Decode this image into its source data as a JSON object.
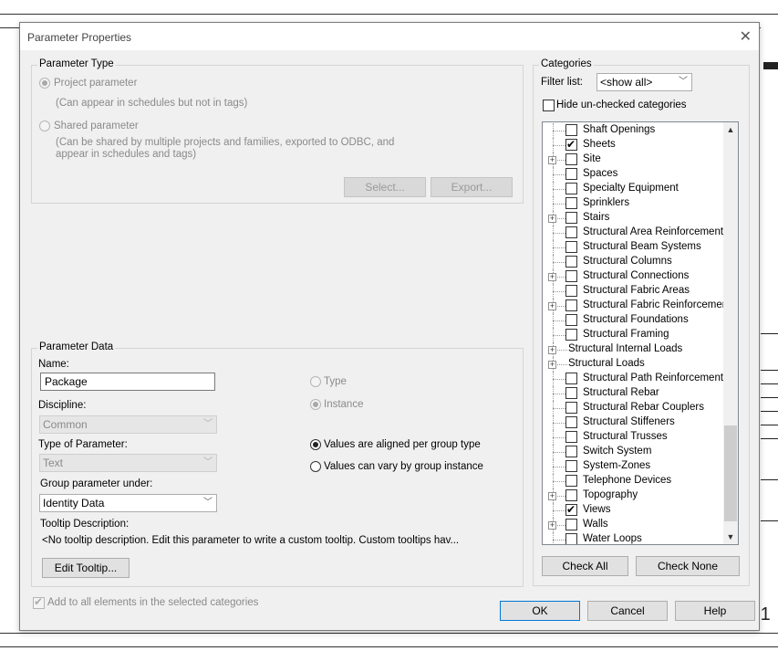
{
  "dialog": {
    "title": "Parameter Properties",
    "close_glyph": "✕"
  },
  "parameter_type": {
    "legend": "Parameter Type",
    "project_label": "Project parameter",
    "project_desc": "(Can appear in schedules but not in tags)",
    "shared_label": "Shared parameter",
    "shared_desc_1": "(Can be shared by multiple projects and families, exported to ODBC, and",
    "shared_desc_2": "appear in schedules and tags)",
    "select_button": "Select...",
    "export_button": "Export..."
  },
  "parameter_data": {
    "legend": "Parameter Data",
    "name_label": "Name:",
    "name_value": "Package",
    "discipline_label": "Discipline:",
    "discipline_value": "Common",
    "type_label": "Type of Parameter:",
    "type_value": "Text",
    "group_label": "Group parameter under:",
    "group_value": "Identity Data",
    "tooltip_label": "Tooltip Description:",
    "tooltip_value": "<No tooltip description. Edit this parameter to write a custom tooltip. Custom tooltips hav...",
    "edit_tooltip_button": "Edit Tooltip...",
    "type_radio": "Type",
    "instance_radio": "Instance",
    "aligned_radio": "Values are aligned per group type",
    "vary_radio": "Values can vary by group instance"
  },
  "categories": {
    "legend": "Categories",
    "filter_label": "Filter list:",
    "filter_value": "<show all>",
    "hide_unchecked_label": "Hide un-checked categories",
    "check_all_button": "Check All",
    "check_none_button": "Check None",
    "items": [
      {
        "label": "Shaft Openings",
        "checked": false,
        "expandable": false,
        "checkbox": true
      },
      {
        "label": "Sheets",
        "checked": true,
        "expandable": false,
        "checkbox": true
      },
      {
        "label": "Site",
        "checked": false,
        "expandable": true,
        "checkbox": true
      },
      {
        "label": "Spaces",
        "checked": false,
        "expandable": false,
        "checkbox": true
      },
      {
        "label": "Specialty Equipment",
        "checked": false,
        "expandable": false,
        "checkbox": true
      },
      {
        "label": "Sprinklers",
        "checked": false,
        "expandable": false,
        "checkbox": true
      },
      {
        "label": "Stairs",
        "checked": false,
        "expandable": true,
        "checkbox": true
      },
      {
        "label": "Structural Area Reinforcement",
        "checked": false,
        "expandable": false,
        "checkbox": true
      },
      {
        "label": "Structural Beam Systems",
        "checked": false,
        "expandable": false,
        "checkbox": true
      },
      {
        "label": "Structural Columns",
        "checked": false,
        "expandable": false,
        "checkbox": true
      },
      {
        "label": "Structural Connections",
        "checked": false,
        "expandable": true,
        "checkbox": true
      },
      {
        "label": "Structural Fabric Areas",
        "checked": false,
        "expandable": false,
        "checkbox": true
      },
      {
        "label": "Structural Fabric Reinforcement",
        "checked": false,
        "expandable": true,
        "checkbox": true
      },
      {
        "label": "Structural Foundations",
        "checked": false,
        "expandable": false,
        "checkbox": true
      },
      {
        "label": "Structural Framing",
        "checked": false,
        "expandable": false,
        "checkbox": true
      },
      {
        "label": "Structural Internal Loads",
        "checked": false,
        "expandable": true,
        "checkbox": false
      },
      {
        "label": "Structural Loads",
        "checked": false,
        "expandable": true,
        "checkbox": false
      },
      {
        "label": "Structural Path Reinforcement",
        "checked": false,
        "expandable": false,
        "checkbox": true
      },
      {
        "label": "Structural Rebar",
        "checked": false,
        "expandable": false,
        "checkbox": true
      },
      {
        "label": "Structural Rebar Couplers",
        "checked": false,
        "expandable": false,
        "checkbox": true
      },
      {
        "label": "Structural Stiffeners",
        "checked": false,
        "expandable": false,
        "checkbox": true
      },
      {
        "label": "Structural Trusses",
        "checked": false,
        "expandable": false,
        "checkbox": true
      },
      {
        "label": "Switch System",
        "checked": false,
        "expandable": false,
        "checkbox": true
      },
      {
        "label": "System-Zones",
        "checked": false,
        "expandable": false,
        "checkbox": true
      },
      {
        "label": "Telephone Devices",
        "checked": false,
        "expandable": false,
        "checkbox": true
      },
      {
        "label": "Topography",
        "checked": false,
        "expandable": true,
        "checkbox": true
      },
      {
        "label": "Views",
        "checked": true,
        "expandable": false,
        "checkbox": true
      },
      {
        "label": "Walls",
        "checked": false,
        "expandable": true,
        "checkbox": true
      },
      {
        "label": "Water Loops",
        "checked": false,
        "expandable": false,
        "checkbox": true
      }
    ]
  },
  "footer": {
    "add_all_label": "Add to all elements in the selected categories",
    "ok_button": "OK",
    "cancel_button": "Cancel",
    "help_button": "Help"
  },
  "background": {
    "sheet_number": "-1"
  },
  "glyphs": {
    "check": "✔",
    "dropdown": "﹀",
    "scroll_up": "▲",
    "scroll_down": "▼",
    "expand": "+"
  }
}
